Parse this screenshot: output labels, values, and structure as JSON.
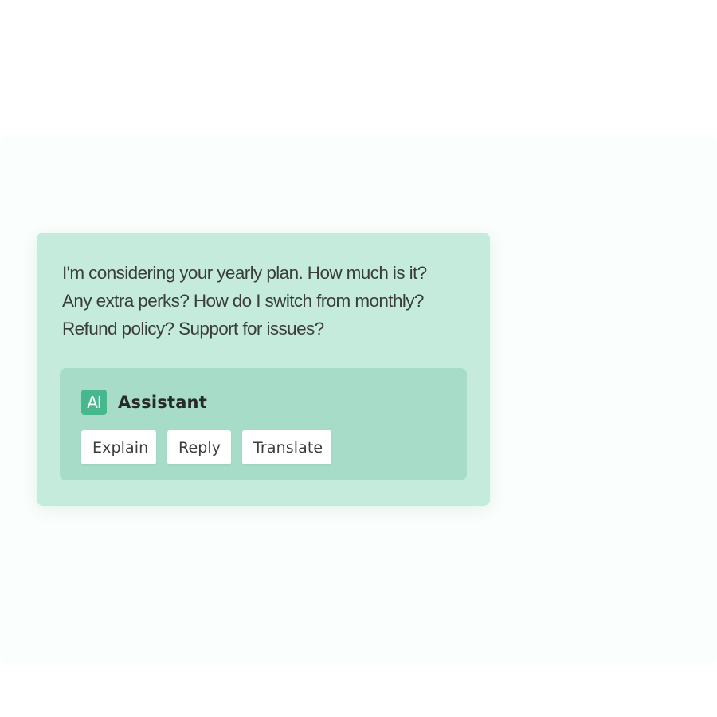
{
  "message": {
    "lines": [
      "I'm considering your yearly plan. How much is it?",
      "Any extra perks? How do I switch from monthly?",
      "Refund policy? Support for issues?"
    ]
  },
  "assistant": {
    "badge": "AI",
    "title": "Assistant",
    "actions": [
      {
        "label": "Explain"
      },
      {
        "label": "Reply"
      },
      {
        "label": "Translate"
      }
    ]
  },
  "colors": {
    "page_background": "#ffffff",
    "stage_background": "#fafefc",
    "card_background": "#c5ebdd",
    "panel_background": "#a7ddc8",
    "badge_background": "#47b88e",
    "button_background": "#ffffff"
  }
}
